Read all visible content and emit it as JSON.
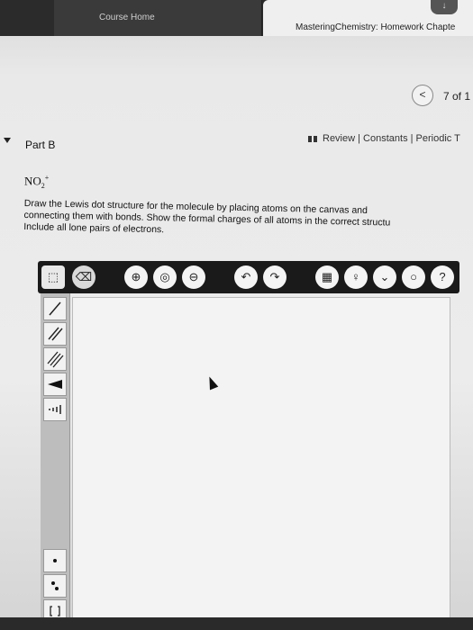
{
  "tabs": {
    "course_home": "Course Home",
    "mastering": "MasteringChemistry: Homework Chapte"
  },
  "pager": {
    "prev": "<",
    "count": "7 of 1"
  },
  "links": {
    "text": "Review | Constants | Periodic T"
  },
  "part": {
    "label": "Part B"
  },
  "formula": {
    "base": "NO",
    "sub": "2",
    "sup": "+"
  },
  "prompt": {
    "line1": "Draw the Lewis dot structure for the molecule by placing atoms on the canvas and",
    "line2": "connecting them with bonds. Show the formal charges of all atoms in the correct structu",
    "line3": "Include all lone pairs of electrons."
  },
  "toolbar": {
    "zoom_in": "⊕",
    "zoom_fit": "◎",
    "zoom_out": "⊖",
    "undo": "↶",
    "redo": "↷",
    "help": "?"
  }
}
